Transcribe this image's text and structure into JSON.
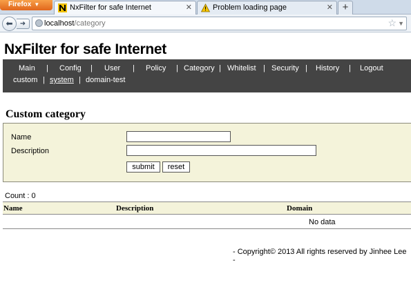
{
  "browser": {
    "app_button": "Firefox",
    "tabs": [
      {
        "title": "NxFilter for safe Internet",
        "active": true
      },
      {
        "title": "Problem loading page",
        "active": false
      }
    ],
    "new_tab": "+",
    "url_host": "localhost",
    "url_path": "/category"
  },
  "site": {
    "title": "NxFilter for safe Internet"
  },
  "menu": {
    "row1": [
      "Main",
      "Config",
      "User",
      "Policy",
      "Category",
      "Whitelist",
      "Security",
      "History",
      "Logout"
    ],
    "row2": [
      "custom",
      "system",
      "domain-test"
    ],
    "separator": "|"
  },
  "form": {
    "heading": "Custom category",
    "name_label": "Name",
    "name_value": "",
    "description_label": "Description",
    "description_value": "",
    "submit_label": "submit",
    "reset_label": "reset"
  },
  "list": {
    "count_text": "Count : 0",
    "columns": [
      "Name",
      "Description",
      "Domain"
    ],
    "empty_text": "No data"
  },
  "footer": {
    "text": "- Copyright© 2013 All rights reserved by Jinhee Lee -"
  },
  "colors": {
    "menu_bg": "#444444",
    "form_bg": "#f4f3da",
    "firefox_orange": "#e1661c"
  }
}
